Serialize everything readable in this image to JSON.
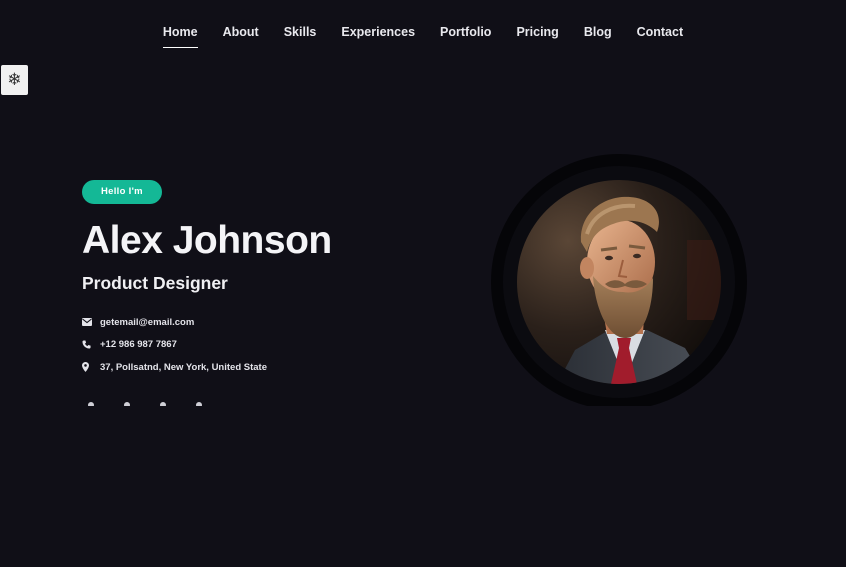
{
  "nav": {
    "items": [
      {
        "label": "Home",
        "active": true
      },
      {
        "label": "About",
        "active": false
      },
      {
        "label": "Skills",
        "active": false
      },
      {
        "label": "Experiences",
        "active": false
      },
      {
        "label": "Portfolio",
        "active": false
      },
      {
        "label": "Pricing",
        "active": false
      },
      {
        "label": "Blog",
        "active": false
      },
      {
        "label": "Contact",
        "active": false
      }
    ]
  },
  "side_widget": {
    "icon": "snowflake-icon",
    "glyph": "❄"
  },
  "hero": {
    "badge": "Hello I'm",
    "name": "Alex Johnson",
    "role": "Product Designer",
    "contacts": [
      {
        "icon": "envelope-icon",
        "text": "getemail@email.com"
      },
      {
        "icon": "phone-icon",
        "text": "+12 986 987 7867"
      },
      {
        "icon": "map-pin-icon",
        "text": "37, Pollsatnd, New York, United State"
      }
    ]
  },
  "colors": {
    "background": "#100f17",
    "accent": "#14b896",
    "text": "#ffffff"
  },
  "portrait": {
    "subject": "bearded-man-photo"
  }
}
